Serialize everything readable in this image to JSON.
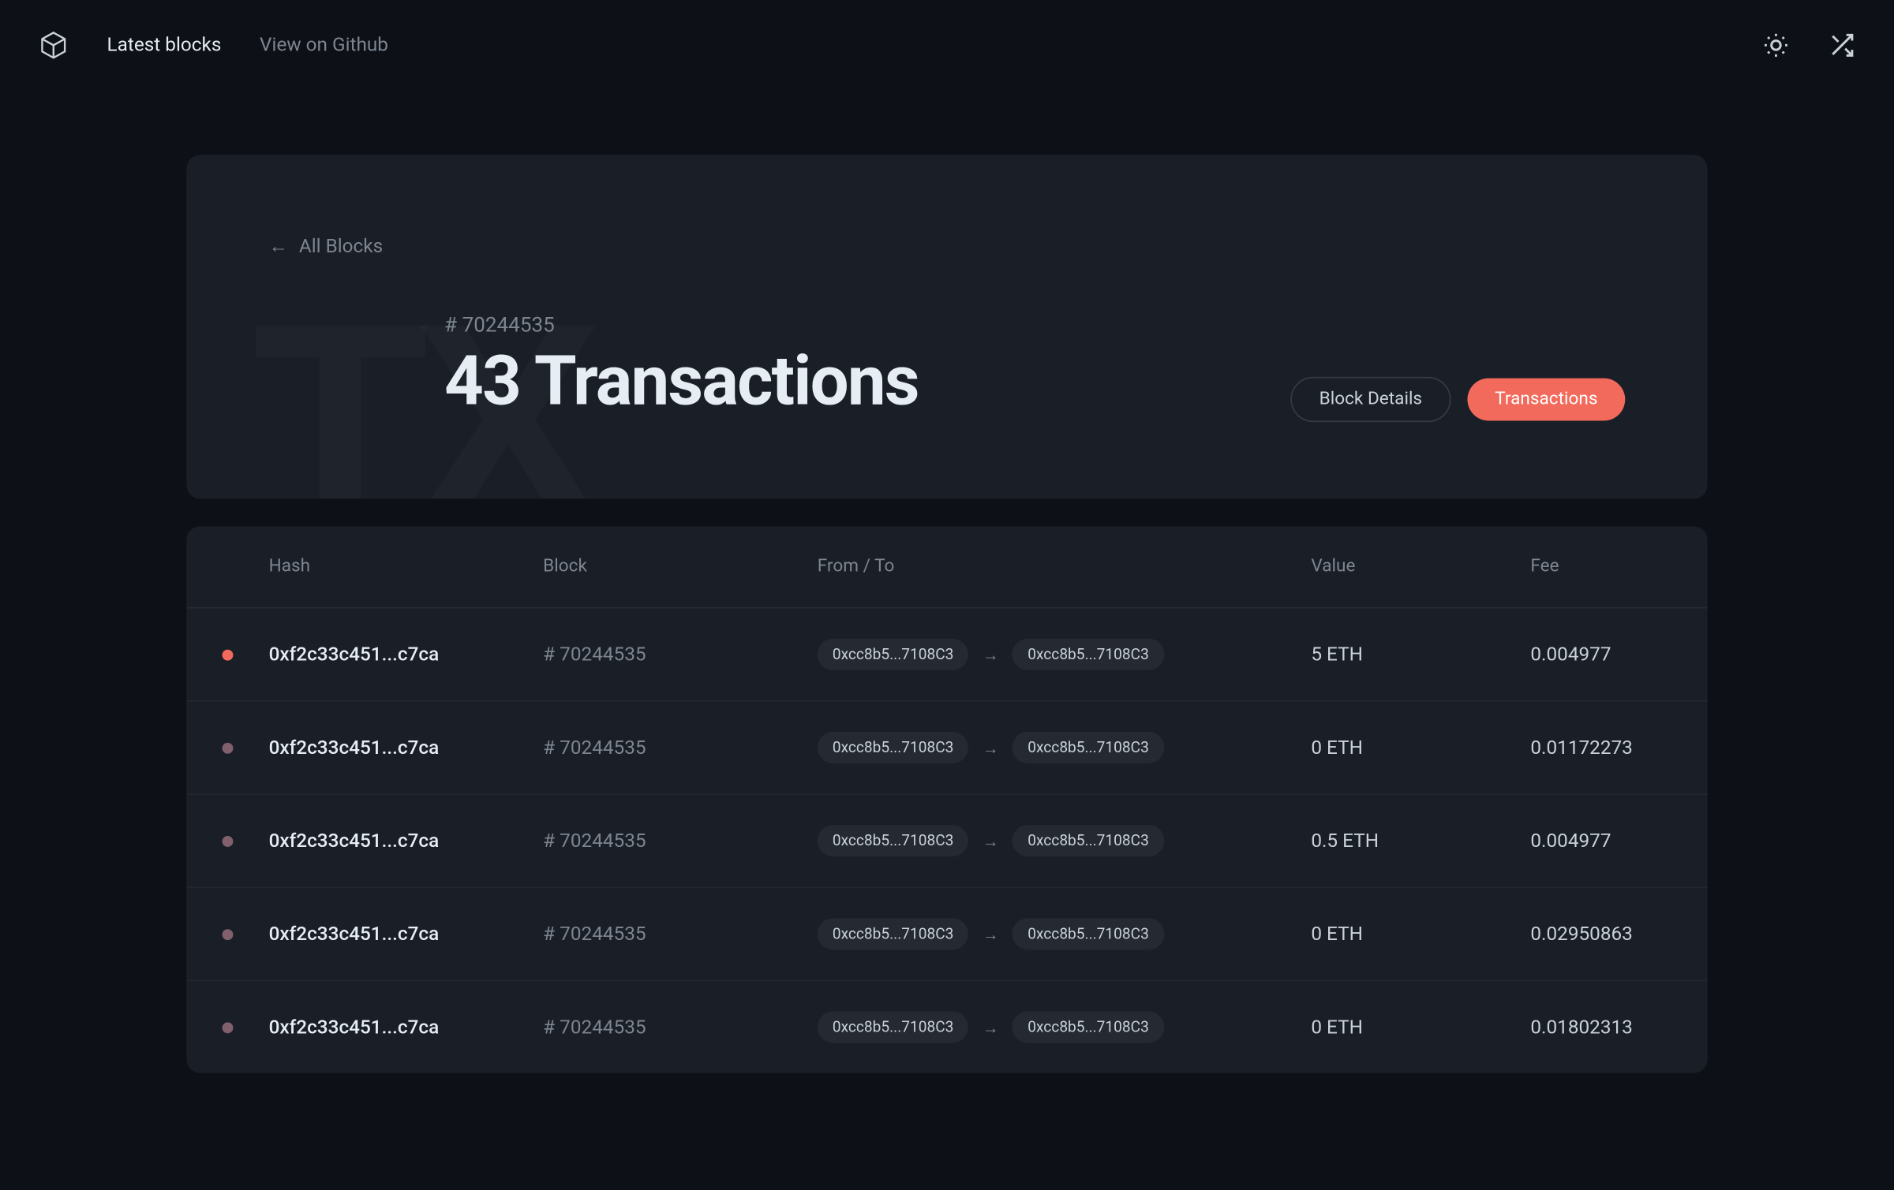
{
  "header": {
    "nav": {
      "latest_blocks": "Latest blocks",
      "view_github": "View on Github"
    }
  },
  "hero": {
    "breadcrumb": "All Blocks",
    "bg_text": "TX",
    "block_number": "# 70244535",
    "title": "43 Transactions",
    "btn_details": "Block Details",
    "btn_transactions": "Transactions"
  },
  "table": {
    "headers": {
      "hash": "Hash",
      "block": "Block",
      "fromto": "From / To",
      "value": "Value",
      "fee": "Fee"
    },
    "rows": [
      {
        "status": "orange",
        "hash": "0xf2c33c451...c7ca",
        "block": "# 70244535",
        "from": "0xcc8b5...7108C3",
        "to": "0xcc8b5...7108C3",
        "value": "5 ETH",
        "fee": "0.004977"
      },
      {
        "status": "pink",
        "hash": "0xf2c33c451...c7ca",
        "block": "# 70244535",
        "from": "0xcc8b5...7108C3",
        "to": "0xcc8b5...7108C3",
        "value": "0 ETH",
        "fee": "0.01172273"
      },
      {
        "status": "pink",
        "hash": "0xf2c33c451...c7ca",
        "block": "# 70244535",
        "from": "0xcc8b5...7108C3",
        "to": "0xcc8b5...7108C3",
        "value": "0.5 ETH",
        "fee": "0.004977"
      },
      {
        "status": "pink",
        "hash": "0xf2c33c451...c7ca",
        "block": "# 70244535",
        "from": "0xcc8b5...7108C3",
        "to": "0xcc8b5...7108C3",
        "value": "0 ETH",
        "fee": "0.02950863"
      },
      {
        "status": "pink",
        "hash": "0xf2c33c451...c7ca",
        "block": "# 70244535",
        "from": "0xcc8b5...7108C3",
        "to": "0xcc8b5...7108C3",
        "value": "0 ETH",
        "fee": "0.01802313"
      }
    ]
  }
}
